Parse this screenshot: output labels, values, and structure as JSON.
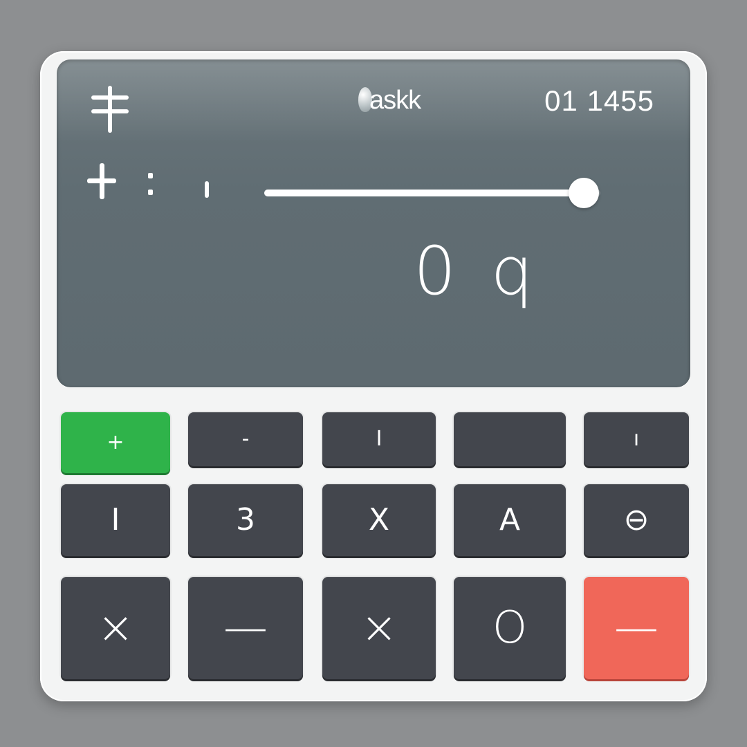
{
  "display": {
    "brand": "askk",
    "readout": "01 1455",
    "main_value": "0 q",
    "slider_level": 0.95
  },
  "keypad": {
    "row1": [
      "+",
      "-",
      "I",
      "",
      "ı"
    ],
    "row2": [
      "I",
      "3",
      "X",
      "A",
      "⊖"
    ],
    "row3": [
      "×",
      "—",
      "×",
      "O",
      "—"
    ]
  },
  "colors": {
    "screen": "#606d73",
    "key": "#43464d",
    "key_green": "#2fb34a",
    "key_red": "#f06759",
    "bezel": "#f3f4f4",
    "background": "#8d8f91"
  }
}
